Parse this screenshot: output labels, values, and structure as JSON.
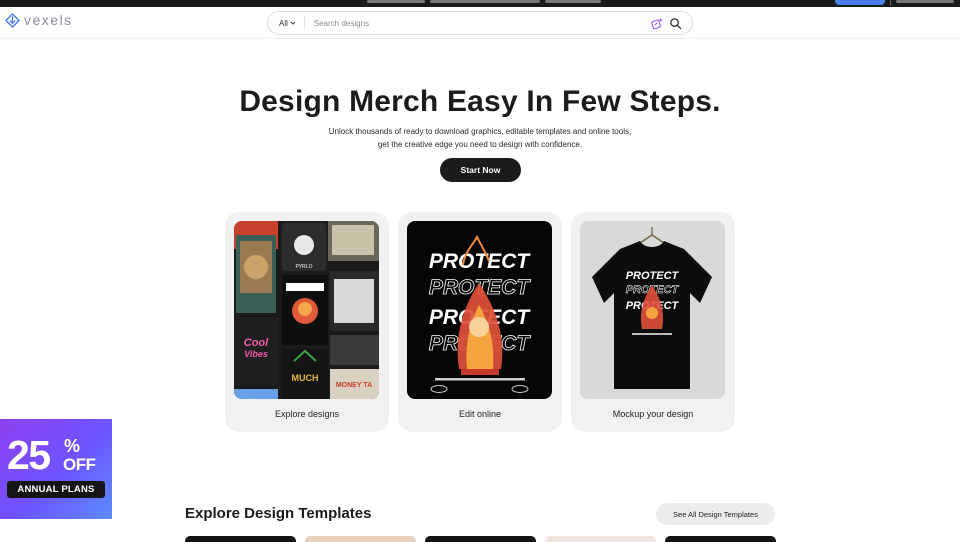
{
  "header": {
    "logo_text": "vexels",
    "search": {
      "category_label": "All",
      "placeholder": "Search designs",
      "value": ""
    }
  },
  "hero": {
    "title": "Design Merch Easy In Few Steps.",
    "subtitle_line1": "Unlock thousands of ready to download graphics, editable templates and online tools,",
    "subtitle_line2": "get the creative edge you need to design with confidence.",
    "cta_label": "Start Now"
  },
  "cards": [
    {
      "label": "Explore designs"
    },
    {
      "label": "Edit online"
    },
    {
      "label": "Mockup your design"
    }
  ],
  "artwork": {
    "protect_word": "PROTECT",
    "small_words": [
      "PYRLO",
      "MONEY TA",
      "MUCH"
    ]
  },
  "promo": {
    "number": "25",
    "percent": "%",
    "off": "OFF",
    "plans": "ANNUAL PLANS"
  },
  "templates": {
    "title": "Explore Design Templates",
    "see_all_label": "See All Design Templates"
  },
  "colors": {
    "accent": "#4a7de8",
    "cta": "#1b1b1b",
    "card_bg": "#f1f1f1",
    "promo_start": "#8e3ff0",
    "promo_end": "#5a8cff"
  }
}
